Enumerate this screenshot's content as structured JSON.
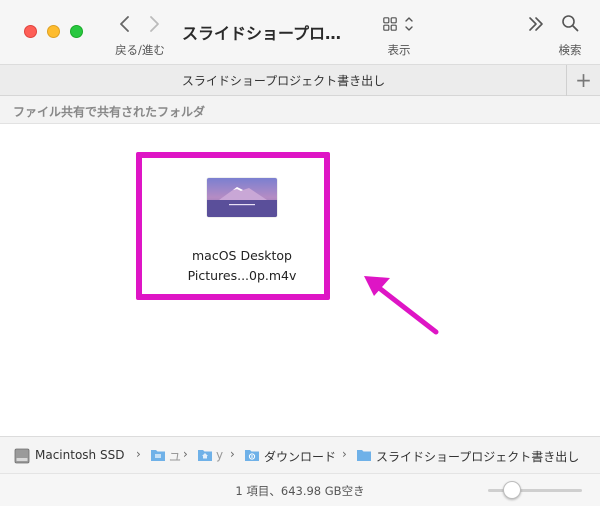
{
  "toolbar": {
    "window_title": "スライドショープロ…",
    "nav_label": "戻る/進む",
    "view_label": "表示",
    "search_label": "検索"
  },
  "tab": {
    "title": "スライドショープロジェクト書き出し",
    "add_label": "+"
  },
  "header": {
    "shared_label": "ファイル共有で共有されたフォルダ"
  },
  "file": {
    "name_line1": "macOS Desktop",
    "name_line2": "Pictures...0p.m4v",
    "thumbnail_icon": "mountain-video-thumbnail"
  },
  "pathbar": {
    "items": [
      {
        "label": "Macintosh SSD",
        "icon": "hard-drive-icon"
      },
      {
        "label": "ユ",
        "icon": "folder-icon"
      },
      {
        "label": "y",
        "icon": "home-folder-icon"
      },
      {
        "label": "ダウンロード",
        "icon": "downloads-folder-icon"
      },
      {
        "label": "スライドショープロジェクト書き出し",
        "icon": "folder-icon"
      }
    ],
    "separator": "›"
  },
  "status": {
    "text": "1 項目、643.98 GB空き",
    "zoom_level": 0.16
  },
  "colors": {
    "highlight": "#de15c5",
    "folder_blue": "#6fb1e8"
  }
}
